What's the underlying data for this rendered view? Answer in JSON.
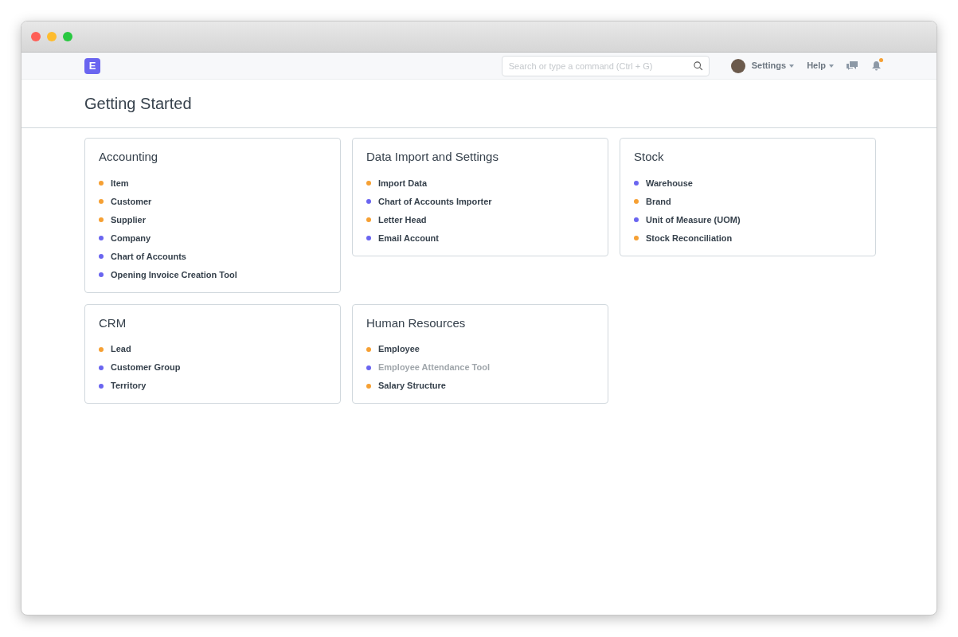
{
  "navbar": {
    "logo": "E",
    "search": {
      "placeholder": "Search or type a command (Ctrl + G)"
    },
    "menus": [
      {
        "label": "Settings"
      },
      {
        "label": "Help"
      }
    ],
    "notifications_unread": true
  },
  "page": {
    "title": "Getting Started"
  },
  "cards": [
    {
      "title": "Accounting",
      "items": [
        {
          "label": "Item",
          "color": "#f6a033",
          "disabled": false
        },
        {
          "label": "Customer",
          "color": "#f6a033",
          "disabled": false
        },
        {
          "label": "Supplier",
          "color": "#f6a033",
          "disabled": false
        },
        {
          "label": "Company",
          "color": "#6a65f0",
          "disabled": false
        },
        {
          "label": "Chart of Accounts",
          "color": "#6a65f0",
          "disabled": false
        },
        {
          "label": "Opening Invoice Creation Tool",
          "color": "#6a65f0",
          "disabled": false
        }
      ]
    },
    {
      "title": "Data Import and Settings",
      "items": [
        {
          "label": "Import Data",
          "color": "#f6a033",
          "disabled": false
        },
        {
          "label": "Chart of Accounts Importer",
          "color": "#6a65f0",
          "disabled": false
        },
        {
          "label": "Letter Head",
          "color": "#f6a033",
          "disabled": false
        },
        {
          "label": "Email Account",
          "color": "#6a65f0",
          "disabled": false
        }
      ]
    },
    {
      "title": "Stock",
      "items": [
        {
          "label": "Warehouse",
          "color": "#6a65f0",
          "disabled": false
        },
        {
          "label": "Brand",
          "color": "#f6a033",
          "disabled": false
        },
        {
          "label": "Unit of Measure (UOM)",
          "color": "#6a65f0",
          "disabled": false
        },
        {
          "label": "Stock Reconciliation",
          "color": "#f6a033",
          "disabled": false
        }
      ]
    },
    {
      "title": "CRM",
      "items": [
        {
          "label": "Lead",
          "color": "#f6a033",
          "disabled": false
        },
        {
          "label": "Customer Group",
          "color": "#6a65f0",
          "disabled": false
        },
        {
          "label": "Territory",
          "color": "#6a65f0",
          "disabled": false
        }
      ]
    },
    {
      "title": "Human Resources",
      "items": [
        {
          "label": "Employee",
          "color": "#f6a033",
          "disabled": false
        },
        {
          "label": "Employee Attendance Tool",
          "color": "#6a65f0",
          "disabled": true
        },
        {
          "label": "Salary Structure",
          "color": "#f6a033",
          "disabled": false
        }
      ]
    }
  ]
}
